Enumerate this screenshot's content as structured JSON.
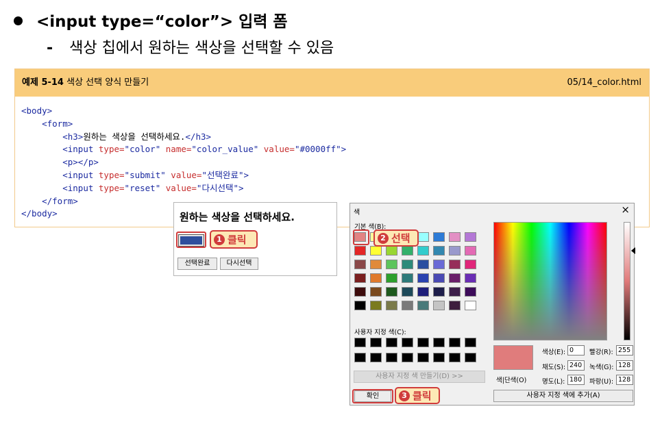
{
  "slide": {
    "title": "<input type=“color”> 입력 폼",
    "subtitle_dash": "-",
    "subtitle": "색상 칩에서 원하는 색상을 선택할 수 있음"
  },
  "example": {
    "label": "예제 5-14",
    "title": "색상 선택 양식 만들기",
    "file": "05/14_color.html"
  },
  "code": {
    "l1_tag": "<body>",
    "l2_tag": "<form>",
    "l3_open": "<h3>",
    "l3_text": "원하는 색상을 선택하세요.",
    "l3_close": "</h3>",
    "l4_tag": "<input",
    "l4_a1": "type=",
    "l4_v1": "\"color\"",
    "l4_a2": "name=",
    "l4_v2": "\"color_value\"",
    "l4_a3": "value=",
    "l4_v3": "\"#0000ff\"",
    "l4_end": ">",
    "l5_tag": "<p></p>",
    "l6_tag": "<input",
    "l6_a1": "type=",
    "l6_v1": "\"submit\"",
    "l6_a2": "value=",
    "l6_v2": "\"선택완료\"",
    "l6_end": ">",
    "l7_tag": "<input",
    "l7_a1": "type=",
    "l7_v1": "\"reset\"",
    "l7_a2": "value=",
    "l7_v2": "\"다시선택\"",
    "l7_end": ">",
    "l8_tag": "</form>",
    "l9_tag": "</body>"
  },
  "browser": {
    "heading": "원하는 색상을 선택하세요.",
    "submit_label": "선택완료",
    "reset_label": "다시선택",
    "swatch_color": "#2f4f9d"
  },
  "callouts": {
    "c1_num": "1",
    "c1_text": "클릭",
    "c2_num": "2",
    "c2_text": "선택",
    "c3_num": "3",
    "c3_text": "클릭"
  },
  "dialog": {
    "title": "색",
    "close": "×",
    "basic_label": "기본 색(B):",
    "custom_label": "사용자 지정 색(C):",
    "define_button": "사용자 지정 색 만들기(D) >>",
    "ok_button": "확인",
    "add_button": "사용자 지정 색에 추가(A)",
    "solid_label": "색|단색(O)",
    "hue_label": "색상(E):",
    "hue_value": "0",
    "sat_label": "채도(S):",
    "sat_value": "240",
    "lum_label": "명도(L):",
    "lum_value": "180",
    "red_label": "빨강(R):",
    "red_value": "255",
    "green_label": "녹색(G):",
    "green_value": "128",
    "blue_label": "파랑(U):",
    "blue_value": "128",
    "preview_color": "#e07c7c",
    "basic_colors": [
      "#e38383",
      "#ffff99",
      "#99e699",
      "#33e0a0",
      "#99ffff",
      "#2d7bd6",
      "#e38fc4",
      "#b478d6",
      "#e32626",
      "#ffff33",
      "#99d633",
      "#33b06a",
      "#33cccc",
      "#3388b0",
      "#9999cc",
      "#e36ab4",
      "#8a4848",
      "#e08a3a",
      "#5cc45c",
      "#2d8a7a",
      "#2a4fa0",
      "#6a6ad6",
      "#962d5a",
      "#e0267a",
      "#7a1e1e",
      "#e07a2d",
      "#2da02d",
      "#2d7a7a",
      "#2a42b0",
      "#4a4ab4",
      "#6a1e6a",
      "#6a2db4",
      "#3d0c0c",
      "#7a4a1e",
      "#1e5a1e",
      "#1e4a5a",
      "#1e1e7a",
      "#1e1e4a",
      "#3d1e4a",
      "#3d0c5a",
      "#000000",
      "#7a7a1e",
      "#7a7a4a",
      "#7a7a7a",
      "#4a7a7a",
      "#c4c4c4",
      "#3d1e3d",
      "#ffffff"
    ]
  }
}
